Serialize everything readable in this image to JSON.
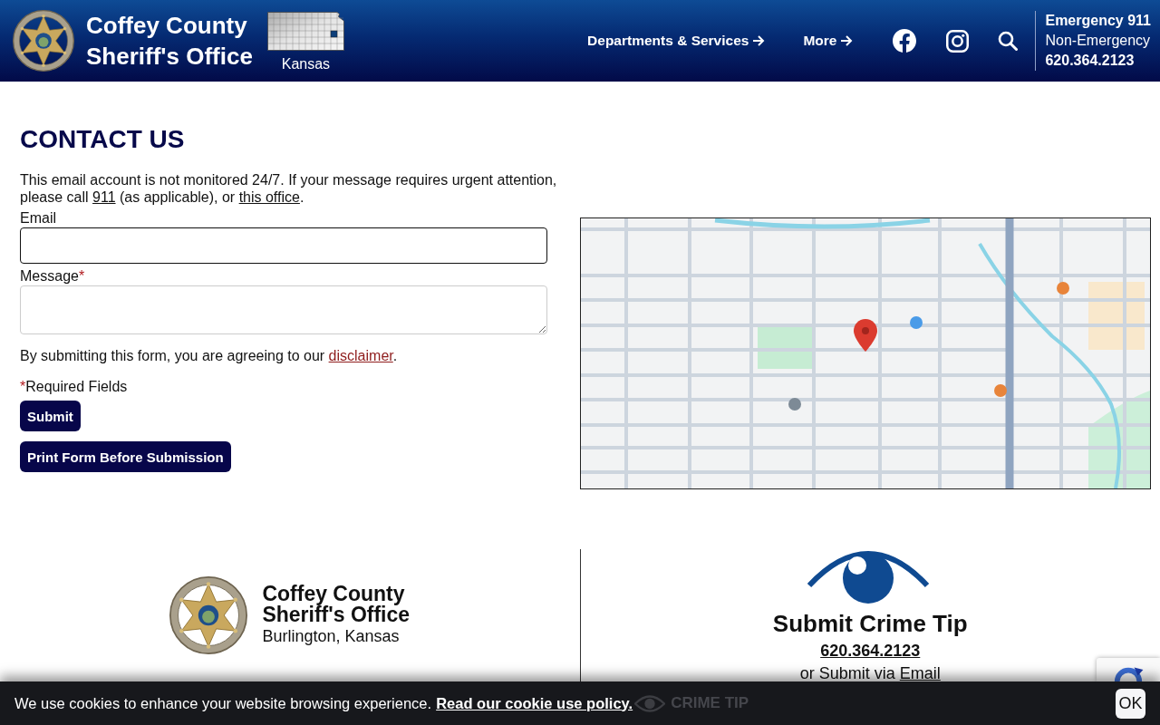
{
  "header": {
    "title_lines": [
      "Coffey County",
      "Sheriff's Office"
    ],
    "state_label": "Kansas",
    "nav": [
      {
        "label": "Departments & Services"
      },
      {
        "label": "More"
      }
    ],
    "contacts": {
      "emergency": "Emergency 911",
      "non_emergency_label": "Non-Emergency",
      "non_emergency_number": "620.364.2123"
    }
  },
  "contact_form": {
    "heading": "CONTACT US",
    "intro": [
      {
        "kind": "text",
        "text": "This email account is not monitored 24/7. If your message requires urgent attention, please call "
      },
      {
        "kind": "link",
        "text": "911"
      },
      {
        "kind": "text",
        "text": " (as applicable), or "
      },
      {
        "kind": "link",
        "text": "this office"
      },
      {
        "kind": "text",
        "text": "."
      }
    ],
    "fields": [
      {
        "kind": "input",
        "label": "Email",
        "focused": true
      },
      {
        "kind": "textarea",
        "label": "Message",
        "required_mark": "*",
        "focused": false
      }
    ],
    "agreement": [
      {
        "kind": "text",
        "text": "By submitting this form, you are agreeing to our "
      },
      {
        "kind": "link",
        "text": "disclaimer"
      },
      {
        "kind": "text",
        "text": "."
      }
    ],
    "required_note": {
      "mark": "*",
      "text": "Required Fields"
    },
    "buttons": [
      {
        "label": "Submit"
      },
      {
        "label": "Print Form Before Submission"
      }
    ]
  },
  "footer": {
    "agency": {
      "name_lines": [
        "Coffey County",
        "Sheriff's Office"
      ],
      "location": "Burlington, Kansas"
    },
    "crime_tip": {
      "title": "Submit Crime Tip",
      "phone": "620.364.2123",
      "alt_parts": [
        {
          "kind": "text",
          "text": "or Submit via "
        },
        {
          "kind": "link",
          "text": "Email"
        }
      ]
    }
  },
  "cookie_bar": {
    "message": "We use cookies to enhance your website browsing experience.",
    "link": "Read our cookie use policy.",
    "faded_link": "CRIME TIP",
    "button": "OK"
  }
}
